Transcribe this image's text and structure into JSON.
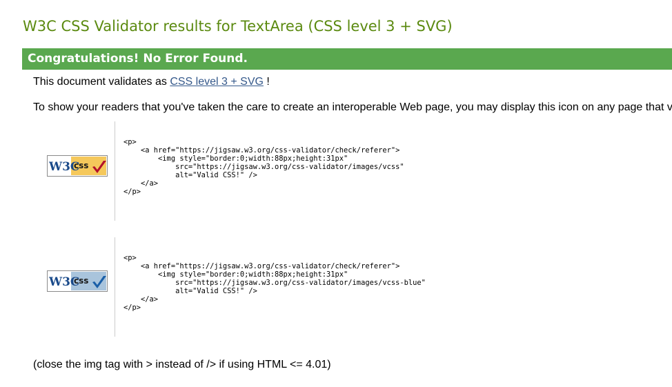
{
  "page": {
    "title": "W3C CSS Validator results for TextArea (CSS level 3 + SVG)"
  },
  "banner": {
    "text": "Congratulations! No Error Found."
  },
  "validates": {
    "prefix": "This document validates as ",
    "link_text": "CSS level 3 + SVG",
    "suffix": " !"
  },
  "readers_text": "To show your readers that you've taken the care to create an interoperable Web page, you may display this icon on any page that v",
  "badges": [
    {
      "w3c_text": "W3C",
      "css_text": "css",
      "code": "<p>\n    <a href=\"https://jigsaw.w3.org/css-validator/check/referer\">\n        <img style=\"border:0;width:88px;height:31px\"\n            src=\"https://jigsaw.w3.org/css-validator/images/vcss\"\n            alt=\"Valid CSS!\" />\n    </a>\n</p>"
    },
    {
      "w3c_text": "W3C",
      "css_text": "css",
      "code": "<p>\n    <a href=\"https://jigsaw.w3.org/css-validator/check/referer\">\n        <img style=\"border:0;width:88px;height:31px\"\n            src=\"https://jigsaw.w3.org/css-validator/images/vcss-blue\"\n            alt=\"Valid CSS!\" />\n    </a>\n</p>"
    }
  ],
  "footnote": "(close the img tag with > instead of /> if using HTML <= 4.01)",
  "colors": {
    "title": "#5b8a10",
    "banner_bg": "#5aa84f",
    "link": "#34588a",
    "badge_gold": "#f5c85b",
    "badge_blue": "#a9c4dc",
    "check_red": "#b3102a",
    "check_blue": "#1a5fa8"
  }
}
